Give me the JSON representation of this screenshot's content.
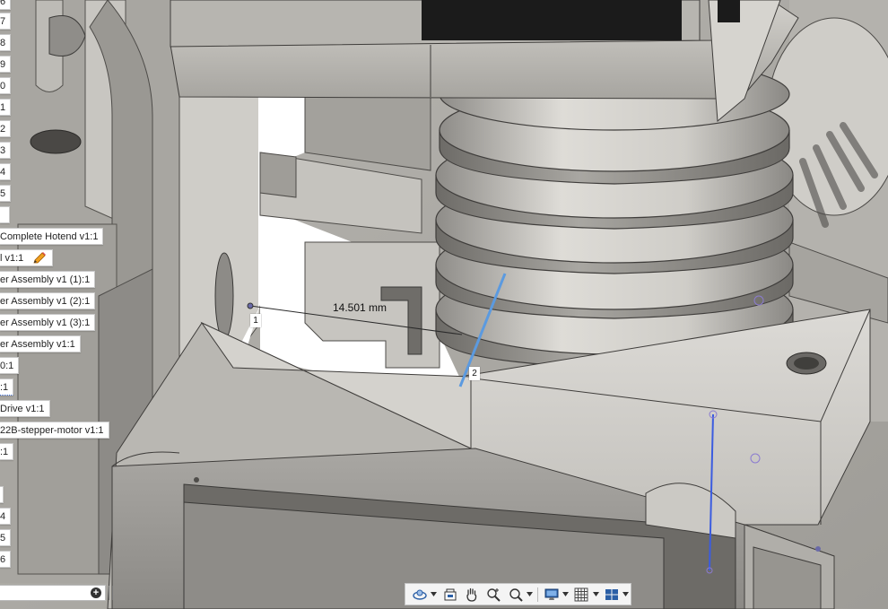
{
  "browser": {
    "rows": [
      {
        "label": "6"
      },
      {
        "label": "7"
      },
      {
        "label": "8"
      },
      {
        "label": "9"
      },
      {
        "label": "0"
      },
      {
        "label": "1"
      },
      {
        "label": "2"
      },
      {
        "label": "3"
      },
      {
        "label": "4"
      },
      {
        "label": "5"
      },
      {
        "label": ""
      },
      {
        "label": "Complete Hotend v1:1"
      },
      {
        "label": "l v1:1"
      },
      {
        "label": "er Assembly v1 (1):1"
      },
      {
        "label": "er Assembly v1 (2):1"
      },
      {
        "label": "er Assembly v1 (3):1"
      },
      {
        "label": "er Assembly v1:1"
      },
      {
        "label": "0:1"
      },
      {
        "label": ":1"
      },
      {
        "label": "Drive v1:1"
      },
      {
        "label": "22B-stepper-motor v1:1"
      },
      {
        "label": ":1"
      },
      {
        "label": ""
      },
      {
        "label": "4"
      },
      {
        "label": "5"
      },
      {
        "label": "6"
      }
    ],
    "search_placeholder": ""
  },
  "measure": {
    "value": "14.501 mm",
    "point1": "1",
    "point2": "2"
  },
  "nav_toolbar": {
    "items": [
      "orbit-icon",
      "look-at-icon",
      "pan-icon",
      "zoom-icon",
      "zoom-window-icon",
      "display-settings-icon",
      "grid-icon",
      "viewports-icon"
    ]
  },
  "colors": {
    "model_body": "#c7c5bf",
    "model_dark": "#7e7c78",
    "measure_line": "#5b9ae0",
    "selection_edge": "#3b5ce0"
  }
}
